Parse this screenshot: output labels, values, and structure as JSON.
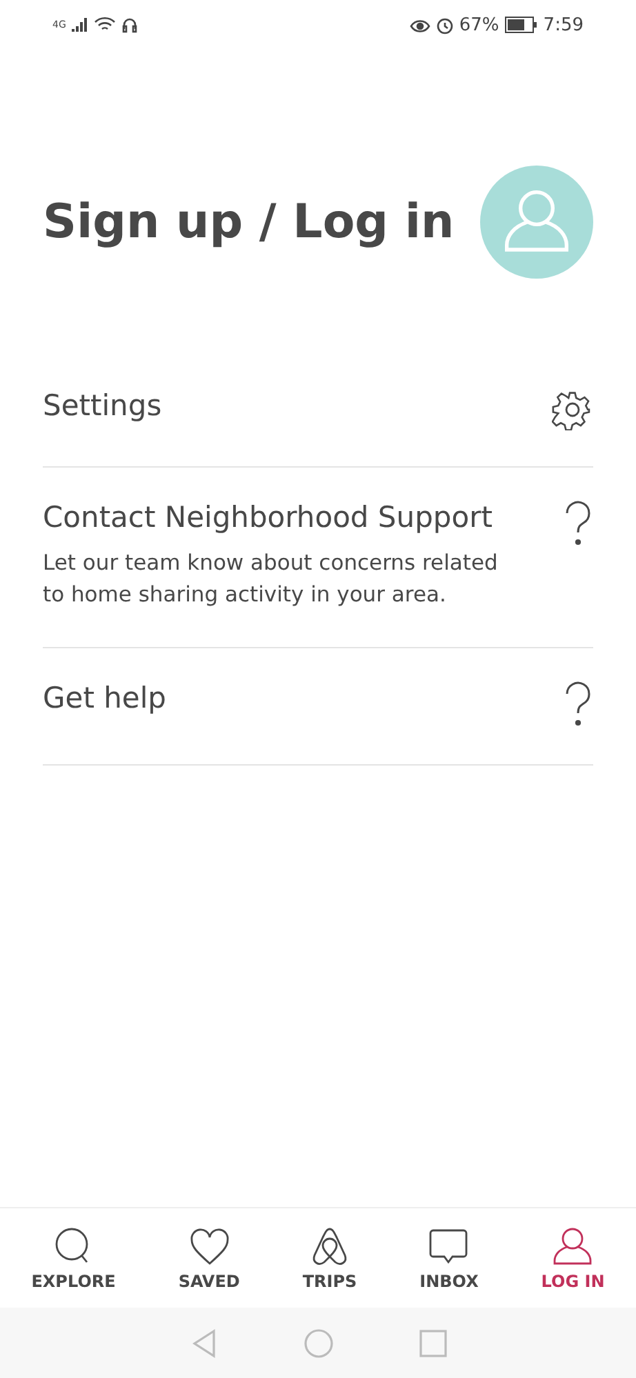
{
  "status_bar": {
    "network": "4G",
    "battery": "67%",
    "time": "7:59"
  },
  "title": "Sign up / Log in",
  "menu": [
    {
      "label": "Settings",
      "kind": "settings"
    },
    {
      "label": "Contact Neighborhood Support",
      "description": "Let our team know about concerns related to home sharing activity in your area.",
      "kind": "help"
    },
    {
      "label": "Get help",
      "kind": "help"
    }
  ],
  "tabs": [
    {
      "label": "EXPLORE",
      "kind": "explore",
      "selected": false
    },
    {
      "label": "SAVED",
      "kind": "saved",
      "selected": false
    },
    {
      "label": "TRIPS",
      "kind": "trips",
      "selected": false
    },
    {
      "label": "INBOX",
      "kind": "inbox",
      "selected": false
    },
    {
      "label": "LOG IN",
      "kind": "login",
      "selected": true
    }
  ]
}
